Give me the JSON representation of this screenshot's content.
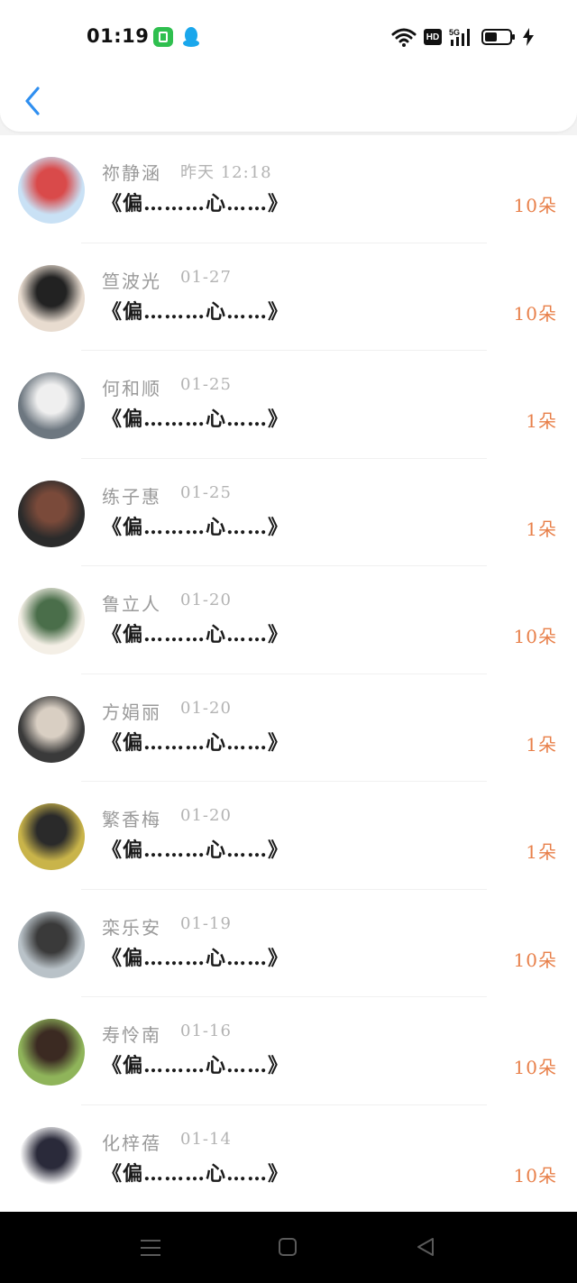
{
  "status_bar": {
    "time": "01:19",
    "hd": "HD",
    "network": "5G"
  },
  "icons": {
    "back": "chevron-left-icon",
    "wifi": "wifi-icon",
    "battery": "battery-icon",
    "nav_menu": "menu-icon",
    "nav_home": "home-icon",
    "nav_back": "back-triangle-icon"
  },
  "colors": {
    "accent": "#2f8ff0",
    "count": "#e8804a"
  },
  "records": [
    {
      "name": "祢静涵",
      "date": "昨天 12:18",
      "gift": "《偏………心……》",
      "count": "10朵",
      "avatar_colors": [
        "#c9e1f5",
        "#d94a4a"
      ]
    },
    {
      "name": "笪波光",
      "date": "01-27",
      "gift": "《偏………心……》",
      "count": "10朵",
      "avatar_colors": [
        "#e8dcd0",
        "#222222"
      ]
    },
    {
      "name": "何和顺",
      "date": "01-25",
      "gift": "《偏………心……》",
      "count": "1朵",
      "avatar_colors": [
        "#6d7780",
        "#efefef"
      ]
    },
    {
      "name": "练子惠",
      "date": "01-25",
      "gift": "《偏………心……》",
      "count": "1朵",
      "avatar_colors": [
        "#2b2b2b",
        "#7a4a3a"
      ]
    },
    {
      "name": "鲁立人",
      "date": "01-20",
      "gift": "《偏………心……》",
      "count": "10朵",
      "avatar_colors": [
        "#f4efe6",
        "#4a6e4a"
      ]
    },
    {
      "name": "方娟丽",
      "date": "01-20",
      "gift": "《偏………心……》",
      "count": "1朵",
      "avatar_colors": [
        "#3a3a3a",
        "#d9cfc3"
      ]
    },
    {
      "name": "繁香梅",
      "date": "01-20",
      "gift": "《偏………心……》",
      "count": "1朵",
      "avatar_colors": [
        "#c9b44a",
        "#2a2a2a"
      ]
    },
    {
      "name": "栾乐安",
      "date": "01-19",
      "gift": "《偏………心……》",
      "count": "10朵",
      "avatar_colors": [
        "#b9c2c8",
        "#3a3a3a"
      ]
    },
    {
      "name": "寿怜南",
      "date": "01-16",
      "gift": "《偏………心……》",
      "count": "10朵",
      "avatar_colors": [
        "#8fb45a",
        "#3b2a22"
      ]
    },
    {
      "name": "化梓蓓",
      "date": "01-14",
      "gift": "《偏………心……》",
      "count": "10朵",
      "avatar_colors": [
        "#ffffff",
        "#2a2a3a"
      ]
    }
  ]
}
